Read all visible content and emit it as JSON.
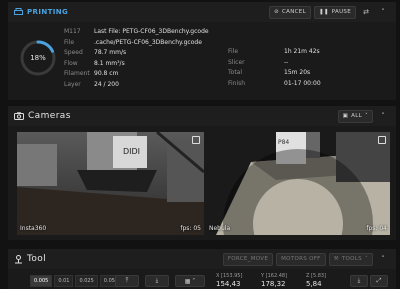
{
  "printing": {
    "title": "PRINTING",
    "cancel_label": "CANCEL",
    "pause_label": "PAUSE",
    "progress_percent": 18,
    "progress_text": "18%",
    "command": "M117",
    "last_file_label": "Last File: PETG-CF06_3DBenchy.gcode",
    "stats_left": [
      {
        "key": "File",
        "value": ".cache/PETG-CF06_3DBenchy.gcode"
      },
      {
        "key": "Speed",
        "value": "78.7 mm/s"
      },
      {
        "key": "Flow",
        "value": "8.1 mm³/s"
      },
      {
        "key": "Filament",
        "value": "90.8 cm"
      },
      {
        "key": "Layer",
        "value": "24 / 200"
      }
    ],
    "stats_right": [
      {
        "key": "File",
        "value": "1h 21m 42s"
      },
      {
        "key": "Slicer",
        "value": "--"
      },
      {
        "key": "Total",
        "value": "15m 20s"
      },
      {
        "key": "Finish",
        "value": "01-17 00:00"
      }
    ]
  },
  "cameras": {
    "title": "Cameras",
    "filter_label": "ALL",
    "feeds": [
      {
        "name": "Insta360",
        "fps": "fps: 05"
      },
      {
        "name": "Nebula",
        "fps": "fps: 04"
      }
    ]
  },
  "tool": {
    "title": "Tool",
    "force_move_label": "FORCE_MOVE",
    "motors_off_label": "MOTORS OFF",
    "tools_label": "TOOLS",
    "steps": [
      "0.005",
      "0.01",
      "0.025",
      "0.05"
    ],
    "selected_step": "0.005",
    "coords": [
      {
        "label": "X [153.95]",
        "value": "154,43"
      },
      {
        "label": "Y [162.48]",
        "value": "178,32"
      },
      {
        "label": "Z [5.83]",
        "value": "5,84"
      }
    ]
  },
  "colors": {
    "accent": "#4aa3df",
    "ring_track": "#3a3a3a"
  }
}
